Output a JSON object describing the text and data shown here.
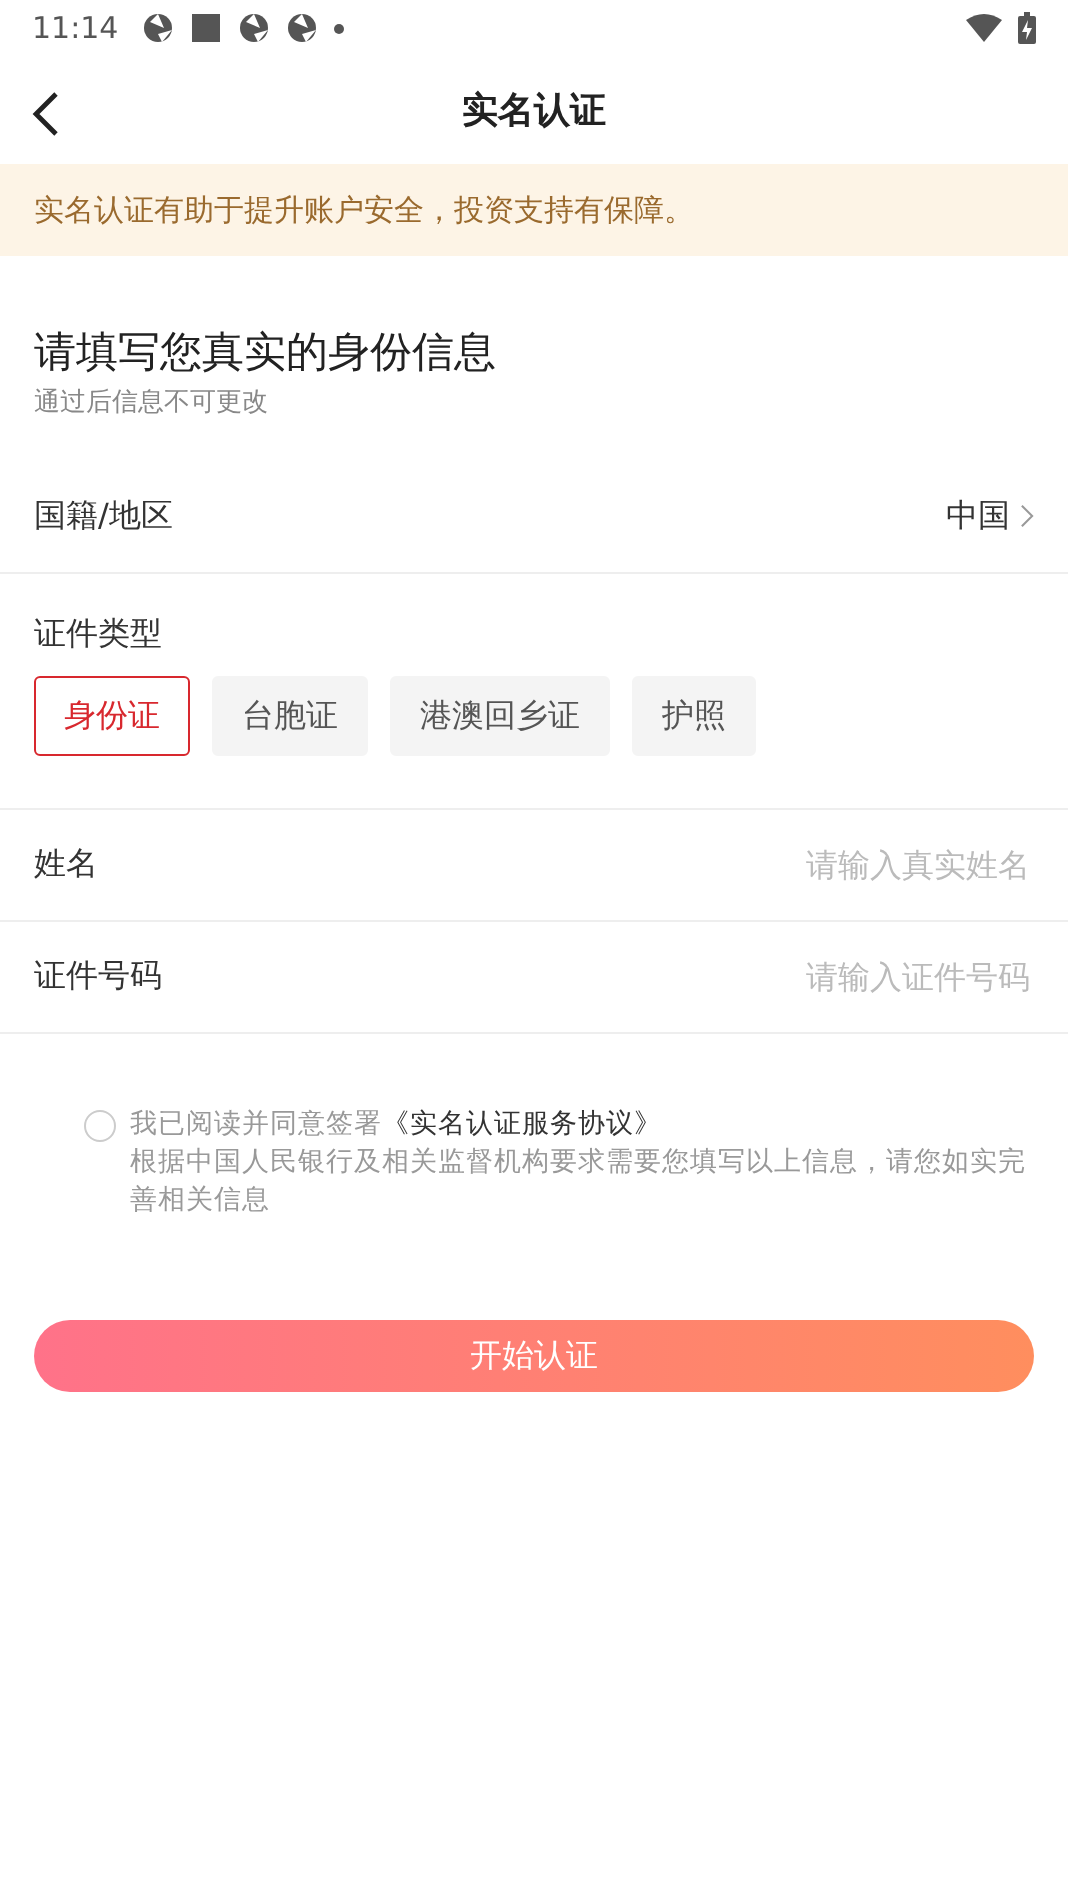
{
  "status_bar": {
    "time": "11:14"
  },
  "nav": {
    "title": "实名认证"
  },
  "notice": "实名认证有助于提升账户安全，投资支持有保障。",
  "heading": {
    "title": "请填写您真实的身份信息",
    "subtitle": "通过后信息不可更改"
  },
  "region": {
    "label": "国籍/地区",
    "value": "中国"
  },
  "id_type": {
    "label": "证件类型",
    "options": [
      {
        "label": "身份证",
        "selected": true
      },
      {
        "label": "台胞证",
        "selected": false
      },
      {
        "label": "港澳回乡证",
        "selected": false
      },
      {
        "label": "护照",
        "selected": false
      }
    ]
  },
  "fields": [
    {
      "label": "姓名",
      "placeholder": "请输入真实姓名"
    },
    {
      "label": "证件号码",
      "placeholder": "请输入证件号码"
    }
  ],
  "agreement": {
    "checked": false,
    "prefix": "我已阅读并同意签署",
    "link": "《实名认证服务协议》",
    "note": "根据中国人民银行及相关监督机构要求需要您填写以上信息，请您如实完善相关信息"
  },
  "submit": "开始认证"
}
